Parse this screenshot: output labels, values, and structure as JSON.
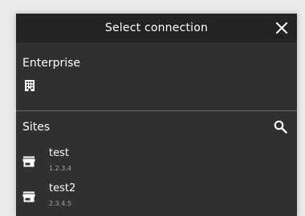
{
  "dialog": {
    "title": "Select connection",
    "close_icon": "close-icon"
  },
  "enterprise": {
    "label": "Enterprise",
    "icon": "building-icon"
  },
  "sites": {
    "label": "Sites",
    "search_icon": "search-icon",
    "items": [
      {
        "name": "test",
        "ip": "1.2.3.4",
        "icon": "store-icon"
      },
      {
        "name": "test2",
        "ip": "2.3.4.5",
        "icon": "store-icon"
      }
    ]
  },
  "colors": {
    "page_background": "#eaeaea",
    "dialog_background": "#303030",
    "titlebar_background": "#232323",
    "text": "#ffffff",
    "secondary_text": "#a8a8a8",
    "divider": "#6a6a6a"
  }
}
